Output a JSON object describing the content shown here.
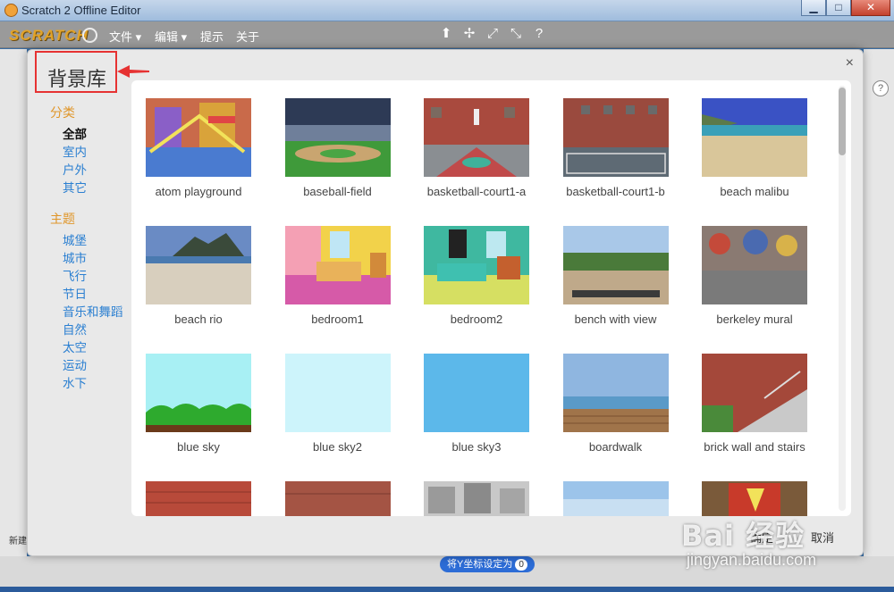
{
  "window": {
    "title": "Scratch 2 Offline Editor",
    "min": "▁",
    "max": "□",
    "close": "✕"
  },
  "menubar": {
    "logo": "SCRATCH",
    "items": [
      "文件 ▾",
      "编辑 ▾",
      "提示",
      "关于"
    ],
    "tool_icons": [
      "stamp-icon",
      "cut-icon",
      "grow-icon",
      "shrink-icon",
      "help-icon"
    ]
  },
  "dialog": {
    "title": "背景库",
    "close": "×",
    "categories_heading": "分类",
    "categories": [
      "全部",
      "室内",
      "户外",
      "其它"
    ],
    "themes_heading": "主题",
    "themes": [
      "城堡",
      "城市",
      "飞行",
      "节日",
      "音乐和舞蹈",
      "自然",
      "太空",
      "运动",
      "水下"
    ],
    "ok": "确定",
    "cancel": "取消",
    "items": [
      "atom playground",
      "baseball-field",
      "basketball-court1-a",
      "basketball-court1-b",
      "beach malibu",
      "beach rio",
      "bedroom1",
      "bedroom2",
      "bench with view",
      "berkeley mural",
      "blue sky",
      "blue sky2",
      "blue sky3",
      "boardwalk",
      "brick wall and stairs",
      "",
      "",
      "",
      "",
      ""
    ]
  },
  "background": {
    "new_label": "新建",
    "block_label": "将Y坐标设定为",
    "block_value": "0",
    "help": "?"
  },
  "watermark": {
    "big": "Bai 经验",
    "small": "jingyan.baidu.com"
  },
  "colors": {
    "accent_red": "#e63232",
    "category_orange": "#e0962a",
    "link_blue": "#2a7fd1"
  }
}
